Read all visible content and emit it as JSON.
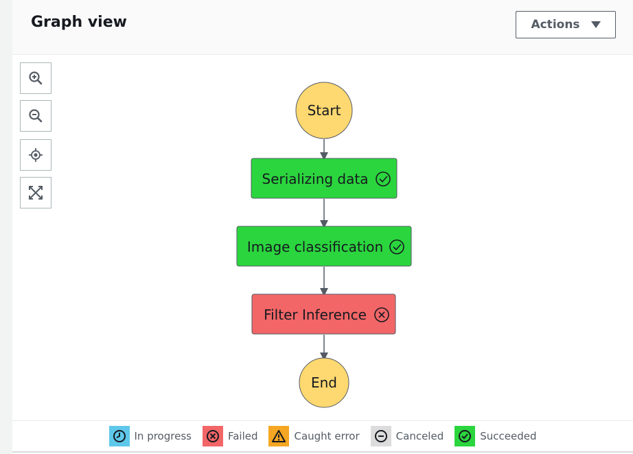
{
  "header": {
    "title": "Graph view",
    "actions_label": "Actions"
  },
  "toolbar": {
    "buttons": [
      {
        "name": "zoom-in",
        "icon": "zoom-in-icon"
      },
      {
        "name": "zoom-out",
        "icon": "zoom-out-icon"
      },
      {
        "name": "center",
        "icon": "center-icon"
      },
      {
        "name": "fit",
        "icon": "fit-icon"
      }
    ]
  },
  "graph": {
    "nodes": [
      {
        "label": "Start",
        "kind": "terminal",
        "status": "none"
      },
      {
        "label": "Serializing data",
        "kind": "state",
        "status": "succeeded"
      },
      {
        "label": "Image classification",
        "kind": "state",
        "status": "succeeded"
      },
      {
        "label": "Filter Inference",
        "kind": "state",
        "status": "failed"
      },
      {
        "label": "End",
        "kind": "terminal",
        "status": "none"
      }
    ]
  },
  "legend": [
    {
      "label": "In progress",
      "color": "#5ec8ea",
      "icon": "clock-icon"
    },
    {
      "label": "Failed",
      "color": "#f26667",
      "icon": "x-circle-icon"
    },
    {
      "label": "Caught error",
      "color": "#f5a623",
      "icon": "warning-icon"
    },
    {
      "label": "Canceled",
      "color": "#dcdcdc",
      "icon": "minus-circle-icon"
    },
    {
      "label": "Succeeded",
      "color": "#2bd53e",
      "icon": "check-circle-icon"
    }
  ],
  "colors": {
    "terminal": "#fed870",
    "succeeded": "#2bd53e",
    "failed": "#f26667"
  }
}
